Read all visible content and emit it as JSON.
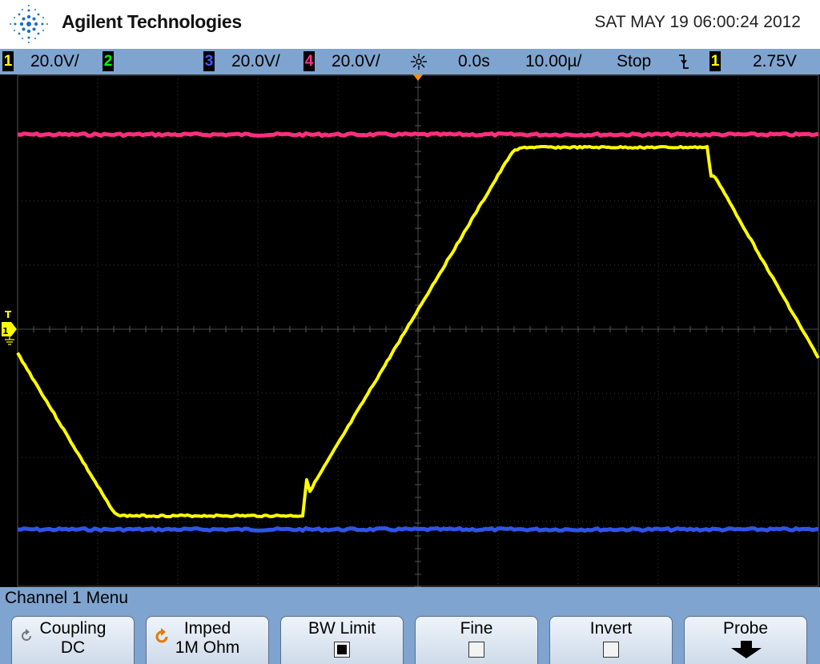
{
  "header": {
    "brand": "Agilent Technologies",
    "datetime": "SAT MAY 19 06:00:24 2012",
    "logo_icon": "agilent-spark-icon"
  },
  "status_bar": {
    "ch1": {
      "num": "1",
      "scale": "20.0V/",
      "color": "#ffff00"
    },
    "ch2": {
      "num": "2",
      "scale": "",
      "color": "#00ff00"
    },
    "ch3": {
      "num": "3",
      "scale": "20.0V/",
      "color": "#3a5bff"
    },
    "ch4": {
      "num": "4",
      "scale": "20.0V/",
      "color": "#ff2e8a"
    },
    "delay_icon": "trigger-delay-icon",
    "delay": "0.0s",
    "timebase": "10.00µ/",
    "run_state": "Stop",
    "trigger_slope_icon": "falling-edge-icon",
    "trigger_source": "1",
    "trigger_level": "2.75V"
  },
  "screen": {
    "trigger_marker_letter": "T",
    "channel_marker_number": "1",
    "ground_icon": "ground-icon",
    "traces": {
      "ch1_color": "#ffff00",
      "ch3_color": "#2f55e8",
      "ch4_color": "#ff2e7e"
    }
  },
  "menu": {
    "title": "Channel 1  Menu",
    "softkeys": [
      {
        "label": "Coupling",
        "value": "DC",
        "icon": "cycle-arrow-icon"
      },
      {
        "label": "Imped",
        "value": "1M Ohm",
        "icon": "cycle-arrow-icon"
      },
      {
        "label": "BW Limit",
        "checked": true
      },
      {
        "label": "Fine",
        "checked": false
      },
      {
        "label": "Invert",
        "checked": false
      },
      {
        "label": "Probe",
        "icon": "down-arrow-icon"
      }
    ]
  }
}
